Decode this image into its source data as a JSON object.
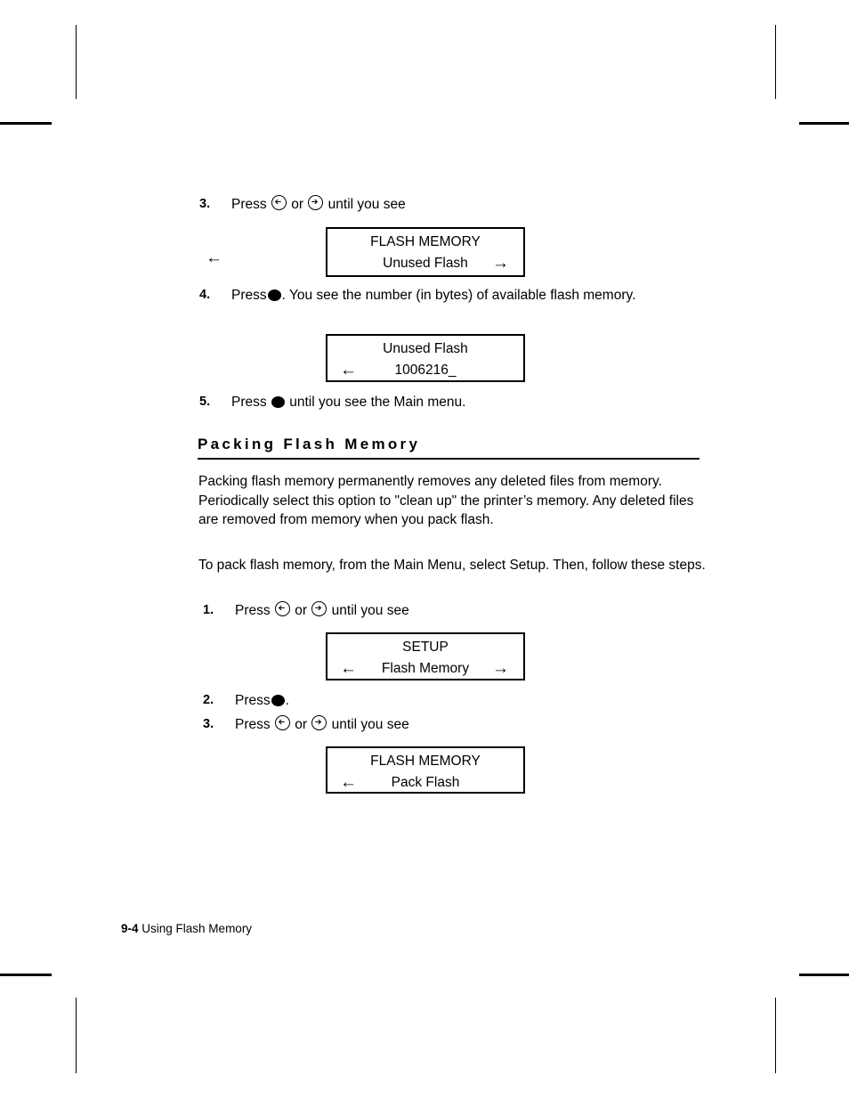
{
  "page": {
    "footer_page_number": "9-4",
    "footer_chapter_title": "Using Flash Memory"
  },
  "icons": {
    "left_key": "circled-left-arrow-icon",
    "right_key": "circled-right-arrow-icon",
    "select_key": "filled-circle-select-key-icon",
    "lcd_left_arrow": "←",
    "lcd_right_arrow": "→"
  },
  "section_top": {
    "steps": [
      {
        "number": "3.",
        "text_before": "Press",
        "text_middle": "or",
        "text_after": "until you see"
      },
      {
        "number": "4.",
        "text_before": "Press",
        "text_after": ".  You see the number (in bytes) of available flash memory."
      },
      {
        "number": "5.",
        "text_before": "Press",
        "text_after": "until you see the Main menu."
      }
    ],
    "display_1": {
      "line1": "FLASH MEMORY",
      "line2": "Unused Flash",
      "arrow_left": "",
      "arrow_right": "→",
      "stray_left_arrow": "←"
    },
    "display_2": {
      "line1": "Unused Flash",
      "line2": "1006216_",
      "arrow_left": "←",
      "arrow_right": ""
    }
  },
  "section_packing": {
    "heading": "Packing Flash Memory",
    "paragraph_1": "Packing flash memory permanently removes any deleted files from memory.  Periodically select this option to \"clean up\" the printer’s memory.  Any deleted files are removed from memory when you pack flash.",
    "paragraph_2": "To pack flash memory, from the Main Menu, select Setup.  Then, follow these steps.",
    "steps": [
      {
        "number": "1.",
        "text_before": "Press",
        "text_middle": "or",
        "text_after": "until you see"
      },
      {
        "number": "2.",
        "text_before": "Press",
        "text_after": "."
      },
      {
        "number": "3.",
        "text_before": "Press",
        "text_middle": "or",
        "text_after": "until you see"
      }
    ],
    "display_1": {
      "line1": "SETUP",
      "line2": "Flash Memory",
      "arrow_left": "←",
      "arrow_right": "→"
    },
    "display_2": {
      "line1": "FLASH MEMORY",
      "line2": "Pack Flash",
      "arrow_left": "←",
      "arrow_right": ""
    }
  }
}
